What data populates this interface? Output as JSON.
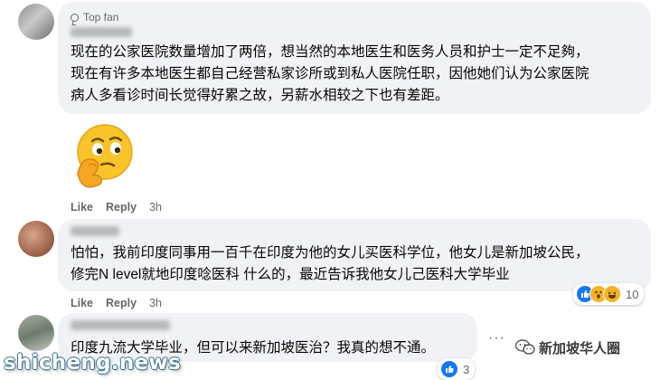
{
  "comments": [
    {
      "badge": "Top fan",
      "lines": [
        "现在的公家医院数量增加了两倍，想当然的本地医生和医务人员和护士一定不足夠，",
        "现在有许多本地医生都自己经营私家诊所或到私人医院任职，因他她们认为公家医院",
        "病人多看诊时间长觉得好累之故，另薪水相较之下也有差距。"
      ],
      "sticker": "thinking-face-sticker",
      "like_label": "Like",
      "reply_label": "Reply",
      "time": "3h"
    },
    {
      "lines": [
        "怕怕，我前印度同事用一百千在印度为他的女儿买医科学位，他女儿是新加坡公民，",
        "修完N level就地印度唸医科 什么的，最近告诉我他女儿己医科大学毕业"
      ],
      "like_label": "Like",
      "reply_label": "Reply",
      "time": "3h",
      "reaction_count": "10",
      "reaction_icons": [
        "like-icon",
        "wow-icon",
        "haha-icon"
      ]
    },
    {
      "lines": [
        "印度九流大学毕业，但可以来新加坡医治？我真的想不通。"
      ],
      "reaction_count": "3",
      "reaction_icons": [
        "like-icon"
      ]
    }
  ],
  "watermark": {
    "account": "新加坡华人圈",
    "site": "shicheng.news"
  },
  "colors": {
    "bubble": "#f0f2f5",
    "secondary_text": "#65676b",
    "like_blue": "#1877f2",
    "emoji_yellow": "#f7b125"
  }
}
